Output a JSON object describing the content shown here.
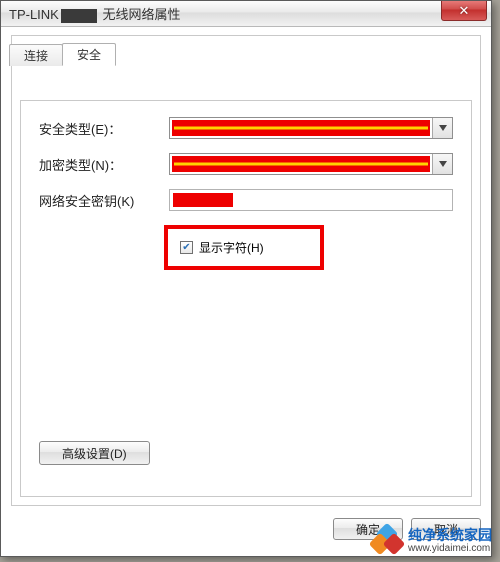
{
  "window": {
    "title_prefix": "TP-LINK",
    "title_suffix": " 无线网络属性",
    "close_label": "✕"
  },
  "tabs": {
    "connect": "连接",
    "security": "安全"
  },
  "form": {
    "security_type_label": "安全类型(E)：",
    "encryption_type_label": "加密类型(N)：",
    "network_key_label": "网络安全密钥(K)",
    "show_chars_label": "显示字符(H)",
    "advanced_button": "高级设置(D)"
  },
  "footer": {
    "ok": "确定",
    "cancel": "取消"
  },
  "watermark": {
    "name": "纯净系统家园",
    "url": "www.yidaimei.com"
  }
}
